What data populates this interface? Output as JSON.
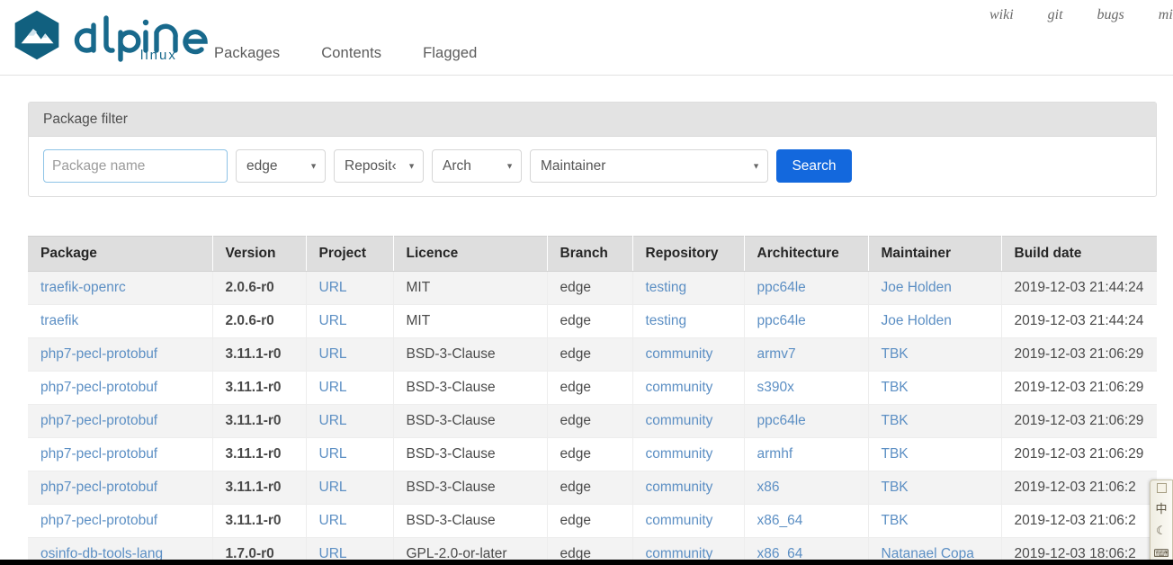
{
  "header": {
    "brand": {
      "name": "alpine",
      "subtitle": "linux",
      "logo_icon": "alpine-mountain-hexagon-icon",
      "hex_color": "#11607f",
      "word_color": "#18698c"
    },
    "nav": [
      {
        "label": "Packages",
        "name": "nav-packages"
      },
      {
        "label": "Contents",
        "name": "nav-contents"
      },
      {
        "label": "Flagged",
        "name": "nav-flagged"
      }
    ],
    "util_nav": [
      {
        "label": "wiki",
        "name": "util-nav-wiki"
      },
      {
        "label": "git",
        "name": "util-nav-git"
      },
      {
        "label": "bugs",
        "name": "util-nav-bugs"
      },
      {
        "label": "mir",
        "name": "util-nav-mirrors"
      }
    ]
  },
  "filter": {
    "title": "Package filter",
    "package_input": {
      "placeholder": "Package name",
      "value": ""
    },
    "branch_select": {
      "value": "edge"
    },
    "repo_select": {
      "value": "Reposit‹"
    },
    "arch_select": {
      "value": "Arch"
    },
    "maintainer_select": {
      "value": "Maintainer"
    },
    "search_button": "Search",
    "caret_icon": "chevron-down-icon"
  },
  "table": {
    "columns": [
      "Package",
      "Version",
      "Project",
      "Licence",
      "Branch",
      "Repository",
      "Architecture",
      "Maintainer",
      "Build date"
    ],
    "rows": [
      {
        "package": "traefik-openrc",
        "version": "2.0.6-r0",
        "project": "URL",
        "licence": "MIT",
        "branch": "edge",
        "repository": "testing",
        "architecture": "ppc64le",
        "maintainer": "Joe Holden",
        "build_date": "2019-12-03 21:44:24"
      },
      {
        "package": "traefik",
        "version": "2.0.6-r0",
        "project": "URL",
        "licence": "MIT",
        "branch": "edge",
        "repository": "testing",
        "architecture": "ppc64le",
        "maintainer": "Joe Holden",
        "build_date": "2019-12-03 21:44:24"
      },
      {
        "package": "php7-pecl-protobuf",
        "version": "3.11.1-r0",
        "project": "URL",
        "licence": "BSD-3-Clause",
        "branch": "edge",
        "repository": "community",
        "architecture": "armv7",
        "maintainer": "TBK",
        "build_date": "2019-12-03 21:06:29"
      },
      {
        "package": "php7-pecl-protobuf",
        "version": "3.11.1-r0",
        "project": "URL",
        "licence": "BSD-3-Clause",
        "branch": "edge",
        "repository": "community",
        "architecture": "s390x",
        "maintainer": "TBK",
        "build_date": "2019-12-03 21:06:29"
      },
      {
        "package": "php7-pecl-protobuf",
        "version": "3.11.1-r0",
        "project": "URL",
        "licence": "BSD-3-Clause",
        "branch": "edge",
        "repository": "community",
        "architecture": "ppc64le",
        "maintainer": "TBK",
        "build_date": "2019-12-03 21:06:29"
      },
      {
        "package": "php7-pecl-protobuf",
        "version": "3.11.1-r0",
        "project": "URL",
        "licence": "BSD-3-Clause",
        "branch": "edge",
        "repository": "community",
        "architecture": "armhf",
        "maintainer": "TBK",
        "build_date": "2019-12-03 21:06:29"
      },
      {
        "package": "php7-pecl-protobuf",
        "version": "3.11.1-r0",
        "project": "URL",
        "licence": "BSD-3-Clause",
        "branch": "edge",
        "repository": "community",
        "architecture": "x86",
        "maintainer": "TBK",
        "build_date": "2019-12-03 21:06:2"
      },
      {
        "package": "php7-pecl-protobuf",
        "version": "3.11.1-r0",
        "project": "URL",
        "licence": "BSD-3-Clause",
        "branch": "edge",
        "repository": "community",
        "architecture": "x86_64",
        "maintainer": "TBK",
        "build_date": "2019-12-03 21:06:2"
      },
      {
        "package": "osinfo-db-tools-lang",
        "version": "1.7.0-r0",
        "project": "URL",
        "licence": "GPL-2.0-or-later",
        "branch": "edge",
        "repository": "community",
        "architecture": "x86_64",
        "maintainer": "Natanael Copa",
        "build_date": "2019-12-03 18:06:2"
      }
    ]
  },
  "ime_toolbar": {
    "buttons": [
      {
        "label": "中",
        "name": "ime-chinese-mode-button"
      },
      {
        "label": "☾",
        "name": "ime-halfwidth-button"
      },
      {
        "label": "⌨",
        "name": "ime-keyboard-button"
      }
    ]
  },
  "colors": {
    "brand_blue": "#11607f",
    "link_blue": "#5c8fc4",
    "version_green": "#2a5d22",
    "search_blue": "#1368dd",
    "header_gray": "#dedede",
    "stripe_gray": "#f3f3f3"
  }
}
